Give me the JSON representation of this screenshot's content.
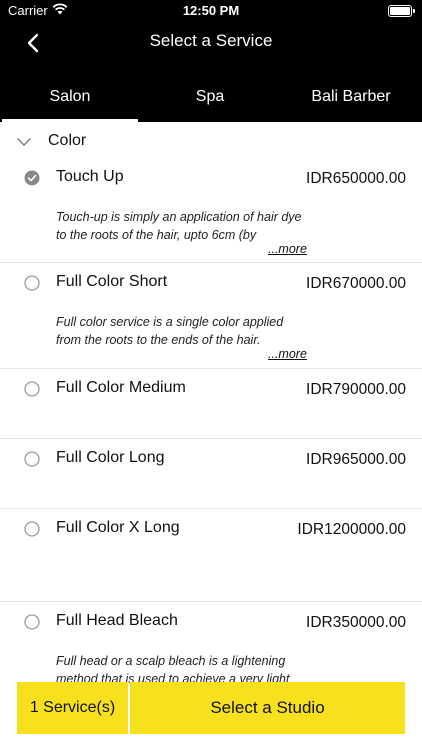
{
  "status_bar": {
    "carrier": "Carrier",
    "time": "12:50 PM"
  },
  "nav": {
    "title": "Select a Service"
  },
  "tabs": [
    {
      "label": "Salon",
      "selected": true
    },
    {
      "label": "Spa",
      "selected": false
    },
    {
      "label": "Bali Barber",
      "selected": false
    }
  ],
  "section": {
    "label": "Color"
  },
  "services": [
    {
      "name": "Touch Up",
      "price": "IDR650000.00",
      "selected": true,
      "description": "Touch-up is simply an application of hair dye to the roots of the hair, upto 6cm (by",
      "more": "...more"
    },
    {
      "name": "Full Color Short",
      "price": "IDR670000.00",
      "selected": false,
      "description": "Full color service is a single color applied from the roots to the ends of the hair.",
      "more": "...more"
    },
    {
      "name": "Full Color Medium",
      "price": "IDR790000.00",
      "selected": false
    },
    {
      "name": "Full Color Long",
      "price": "IDR965000.00",
      "selected": false
    },
    {
      "name": "Full Color X Long",
      "price": "IDR1200000.00",
      "selected": false
    },
    {
      "name": "Full Head Bleach",
      "price": "IDR350000.00",
      "selected": false,
      "description": "Full head or a scalp bleach is a lightening method that is used to achieve a very light"
    }
  ],
  "bottom": {
    "services_count_label": "1 Service(s)",
    "select_studio_label": "Select a Studio"
  },
  "colors": {
    "header_bg": "#000000",
    "accent_yellow": "#f7e01e",
    "radio_selected": "#888888",
    "radio_border": "#9a9a9a"
  }
}
